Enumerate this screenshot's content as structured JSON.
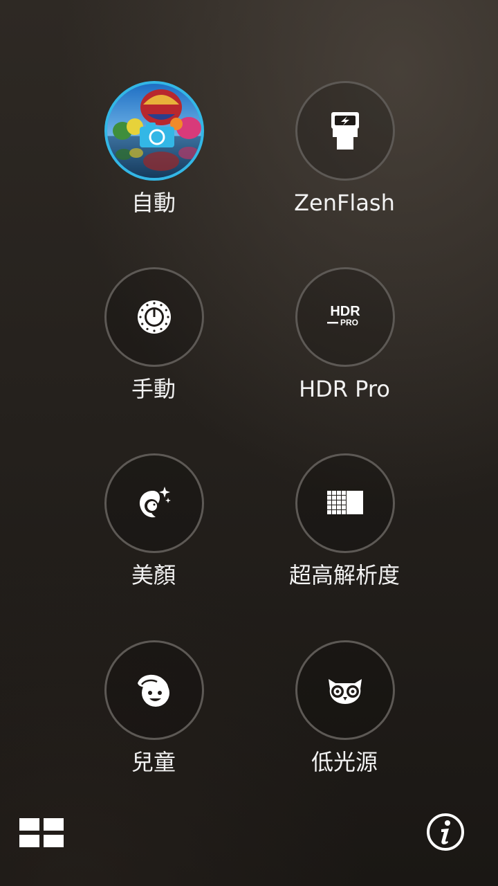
{
  "modes": [
    {
      "label": "自動",
      "icon": "auto-camera-icon",
      "selected": true
    },
    {
      "label": "ZenFlash",
      "icon": "flash-icon",
      "selected": false
    },
    {
      "label": "手動",
      "icon": "dial-icon",
      "selected": false
    },
    {
      "label": "HDR Pro",
      "icon": "hdr-pro-icon",
      "selected": false,
      "icon_text": {
        "main": "HDR",
        "sub": "PRO"
      }
    },
    {
      "label": "美顏",
      "icon": "beauty-face-icon",
      "selected": false
    },
    {
      "label": "超高解析度",
      "icon": "super-resolution-icon",
      "selected": false
    },
    {
      "label": "兒童",
      "icon": "child-face-icon",
      "selected": false
    },
    {
      "label": "低光源",
      "icon": "owl-icon",
      "selected": false
    }
  ],
  "footer": {
    "grid_icon": "grid-icon",
    "info_icon": "info-icon"
  },
  "colors": {
    "selected_ring": "#33b7e6",
    "ring": "#5d5955",
    "label": "#f2f2f2"
  }
}
